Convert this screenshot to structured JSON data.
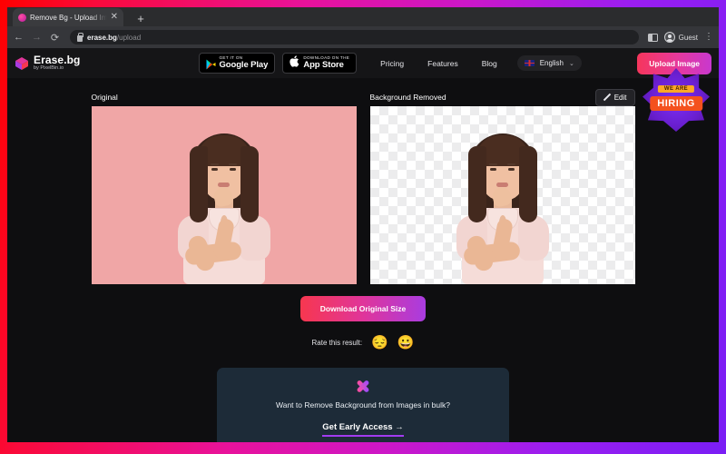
{
  "browser": {
    "tab": {
      "title": "Remove Bg - Upload Images t…",
      "favicon": "erase-bg-favicon",
      "close": "✕"
    },
    "new_tab_label": "+",
    "nav": {
      "back": "←",
      "forward": "→",
      "reload": "⟳"
    },
    "omnibox": {
      "secure_icon": "lock-icon",
      "domain": "erase.bg",
      "path": "/upload"
    },
    "right": {
      "panel_icon": "side-panel-icon",
      "profile_label": "Guest",
      "menu": "⋮"
    }
  },
  "site": {
    "logo": {
      "title": "Erase.bg",
      "subtitle": "by PixelBin.io"
    },
    "store_badges": [
      {
        "small": "GET IT ON",
        "big": "Google Play",
        "icon": "google-play-icon"
      },
      {
        "small": "Download on the",
        "big": "App Store",
        "icon": "apple-icon"
      }
    ],
    "nav_links": [
      "Pricing",
      "Features",
      "Blog"
    ],
    "language": {
      "label": "English",
      "flag": "uk-flag-icon",
      "chevron": "⌄"
    },
    "upload_button": "Upload Image",
    "hiring_badge": {
      "line1": "WE ARE",
      "line2": "HIRING"
    }
  },
  "main": {
    "panels": [
      {
        "label": "Original"
      },
      {
        "label": "Background Removed"
      }
    ],
    "edit_button": "Edit",
    "download_button": "Download Original Size",
    "rating": {
      "label": "Rate this result:",
      "options": [
        {
          "name": "disappointed-emoji",
          "glyph": "😔"
        },
        {
          "name": "grinning-emoji",
          "glyph": "😀"
        }
      ]
    },
    "bulk_card": {
      "icon": "bulk-x-icon",
      "text": "Want to Remove Background from Images in bulk?",
      "link": "Get Early Access →"
    }
  },
  "colors": {
    "frame_start": "#ff0000",
    "frame_mid": "#e8129b",
    "frame_end": "#7a1ef5",
    "accent_pink": "#f6365c",
    "accent_purple": "#a23bf0",
    "page_bg": "#0e0e10",
    "card_bg": "#1d2b38"
  }
}
